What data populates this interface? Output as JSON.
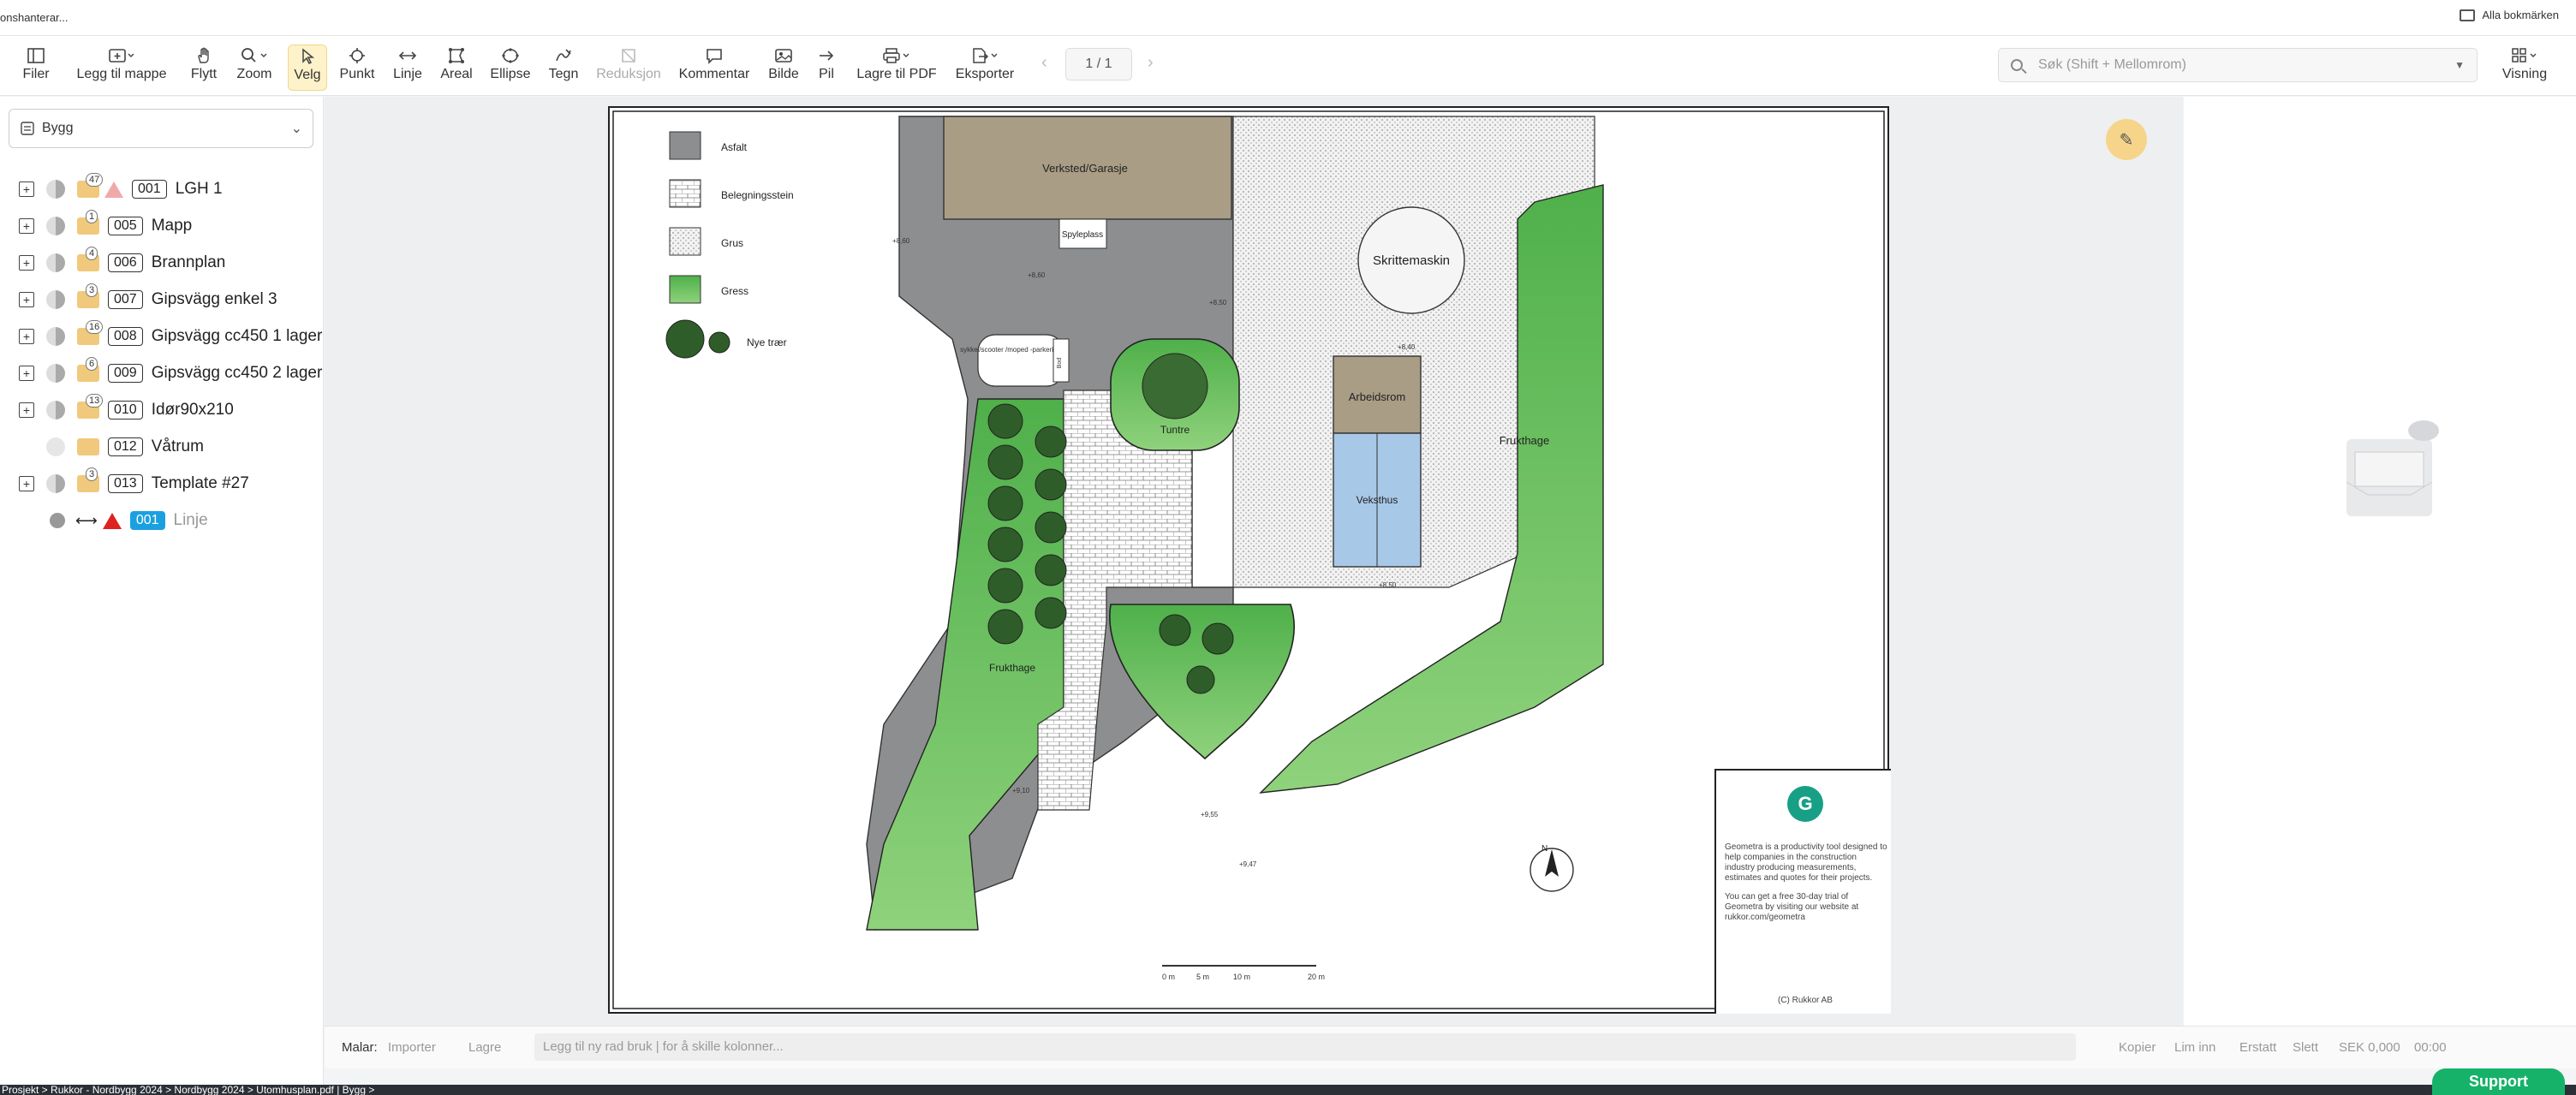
{
  "bookmarks": {
    "left_text": "onshanterar...",
    "right_text": "Alla bokmärken"
  },
  "toolbar": {
    "items": [
      {
        "label": "Filer",
        "icon": "sidebar-icon"
      },
      {
        "label": "Legg til mappe",
        "icon": "folder-plus-icon"
      },
      {
        "label": "Flytt",
        "icon": "hand-icon"
      },
      {
        "label": "Zoom",
        "icon": "magnifier-icon"
      },
      {
        "label": "Velg",
        "icon": "cursor-icon"
      },
      {
        "label": "Punkt",
        "icon": "crosshair-icon"
      },
      {
        "label": "Linje",
        "icon": "arrows-horizontal-icon"
      },
      {
        "label": "Areal",
        "icon": "area-icon"
      },
      {
        "label": "Ellipse",
        "icon": "ellipse-icon"
      },
      {
        "label": "Tegn",
        "icon": "pen-icon"
      },
      {
        "label": "Reduksjon",
        "icon": "reduction-icon"
      },
      {
        "label": "Kommentar",
        "icon": "comment-icon"
      },
      {
        "label": "Bilde",
        "icon": "image-icon"
      },
      {
        "label": "Pil",
        "icon": "arrow-right-icon"
      },
      {
        "label": "Lagre til PDF",
        "icon": "printer-icon"
      },
      {
        "label": "Eksporter",
        "icon": "export-icon"
      }
    ],
    "page": "1 / 1",
    "search_placeholder": "Søk (Shift + Mellomrom)",
    "view_label": "Visning"
  },
  "sidebar": {
    "group": "Bygg",
    "rows": [
      {
        "count": "47",
        "code": "001",
        "name": "LGH 1"
      },
      {
        "count": "1",
        "code": "005",
        "name": "Mapp"
      },
      {
        "count": "4",
        "code": "006",
        "name": "Brannplan"
      },
      {
        "count": "3",
        "code": "007",
        "name": "Gipsvägg enkel 3"
      },
      {
        "count": "16",
        "code": "008",
        "name": "Gipsvägg cc450 1 lager"
      },
      {
        "count": "6",
        "code": "009",
        "name": "Gipsvägg cc450 2 lager"
      },
      {
        "count": "13",
        "code": "010",
        "name": "Idør90x210"
      },
      {
        "count": "",
        "code": "012",
        "name": "Våtrum"
      },
      {
        "count": "3",
        "code": "013",
        "name": "Template #27"
      },
      {
        "count": "",
        "code": "001",
        "name": "Linje"
      }
    ]
  },
  "plan": {
    "legend": [
      "Asfalt",
      "Belegningsstein",
      "Grus",
      "Gress",
      "Nye trær"
    ],
    "labels": {
      "workshop": "Verksted/Garasje",
      "wash": "Spyleplass",
      "skritt": "Skrittemaskin",
      "bike": "sykkel/scooter /moped -parkering",
      "bod": "Bod",
      "tuntre": "Tuntre",
      "arbeid": "Arbeidsrom",
      "veksthus": "Veksthus",
      "frukthage_right": "Frukthage",
      "frukthage_left": "Frukthage"
    },
    "elevations": [
      "+8,60",
      "+8,60",
      "+8,50",
      "+8,40",
      "+8,50",
      "+9,10",
      "+9,55",
      "+9,47"
    ],
    "scale_labels": [
      "0 m",
      "5 m",
      "10 m",
      "20 m"
    ],
    "north": "N",
    "titleblock": {
      "logo": "G",
      "text": "Geometra is a productivity tool designed to help companies in the construction industry producing measurements, estimates and quotes for their projects.",
      "trial": "You can get a free 30-day trial of Geometra by visiting our website at rukkor.com/geometra",
      "copyright": "(C) Rukkor AB"
    }
  },
  "bottombar": {
    "malar": "Malar:",
    "importer": "Importer",
    "lagre": "Lagre",
    "placeholder": "Legg til ny rad bruk | for å skille kolonner...",
    "kopier": "Kopier",
    "lim_inn": "Lim inn",
    "erstatt": "Erstatt",
    "slett": "Slett",
    "sek": "SEK 0,000",
    "time": "00:00"
  },
  "status": {
    "breadcrumb": "Prosjekt  >  Rukkor - Nordbygg 2024 > Nordbygg 2024 > Utomhusplan.pdf  |  Bygg >"
  },
  "support_label": "Support"
}
